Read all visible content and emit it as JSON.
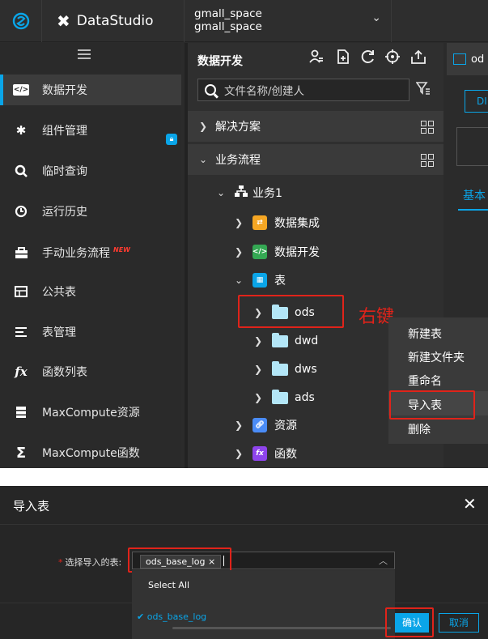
{
  "topbar": {
    "brand": "DataStudio",
    "workspace_line1": "gmall_space",
    "workspace_line2": "gmall_space"
  },
  "nav": [
    {
      "label": "数据开发",
      "icon": "code-icon"
    },
    {
      "label": "组件管理",
      "icon": "puzzle-icon"
    },
    {
      "label": "临时查询",
      "icon": "search-icon"
    },
    {
      "label": "运行历史",
      "icon": "clock-icon"
    },
    {
      "label": "手动业务流程",
      "icon": "briefcase-icon",
      "badge": "NEW"
    },
    {
      "label": "公共表",
      "icon": "table-icon"
    },
    {
      "label": "表管理",
      "icon": "list-icon"
    },
    {
      "label": "函数列表",
      "icon": "fx-icon"
    },
    {
      "label": "MaxCompute资源",
      "icon": "stack-icon"
    },
    {
      "label": "MaxCompute函数",
      "icon": "sigma-icon"
    }
  ],
  "tree": {
    "title": "数据开发",
    "search_placeholder": "文件名称/创建人",
    "sections": [
      "解决方案",
      "业务流程"
    ],
    "workflow": "业务1",
    "nodes": [
      "数据集成",
      "数据开发",
      "表"
    ],
    "tables": [
      "ods",
      "dwd",
      "dws",
      "ads"
    ],
    "more_nodes": [
      "资源",
      "函数"
    ]
  },
  "annotation": "右键",
  "right_tabs": {
    "tab": "od",
    "button": "DI",
    "basic_tab": "基本"
  },
  "context_menu": [
    "新建表",
    "新建文件夹",
    "重命名",
    "导入表",
    "删除"
  ],
  "dialog": {
    "title": "导入表",
    "field_label": "选择导入的表:",
    "selected_tag": "ods_base_log",
    "select_all": "Select All",
    "option": "ods_base_log",
    "ok": "确认",
    "cancel": "取消"
  },
  "colors": {
    "accent": "#0aa5e8",
    "highlight": "#e0231a",
    "dark_bg": "#2b2b2b"
  }
}
